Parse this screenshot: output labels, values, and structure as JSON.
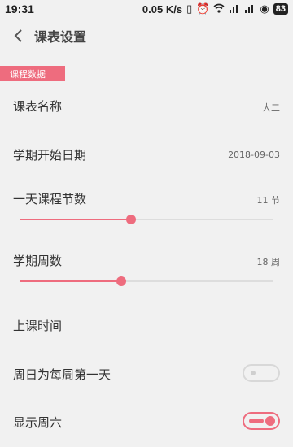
{
  "status": {
    "time": "19:31",
    "speed": "0.05 K/s",
    "battery": "83"
  },
  "appbar": {
    "title": "课表设置"
  },
  "section": {
    "label": "课程数据"
  },
  "rows": {
    "name": {
      "label": "课表名称",
      "value": "大二"
    },
    "start_date": {
      "label": "学期开始日期",
      "value": "2018-09-03"
    },
    "lessons_per_day": {
      "label": "一天课程节数",
      "value": "11  节",
      "slider_fraction": 0.44
    },
    "weeks": {
      "label": "学期周数",
      "value": "18  周",
      "slider_fraction": 0.4
    },
    "class_time": {
      "label": "上课时间"
    },
    "sunday_first": {
      "label": "周日为每周第一天",
      "enabled": false
    },
    "show_saturday": {
      "label": "显示周六",
      "enabled": true
    }
  },
  "colors": {
    "accent": "#ee6c7e",
    "background": "#f1f1f1"
  }
}
